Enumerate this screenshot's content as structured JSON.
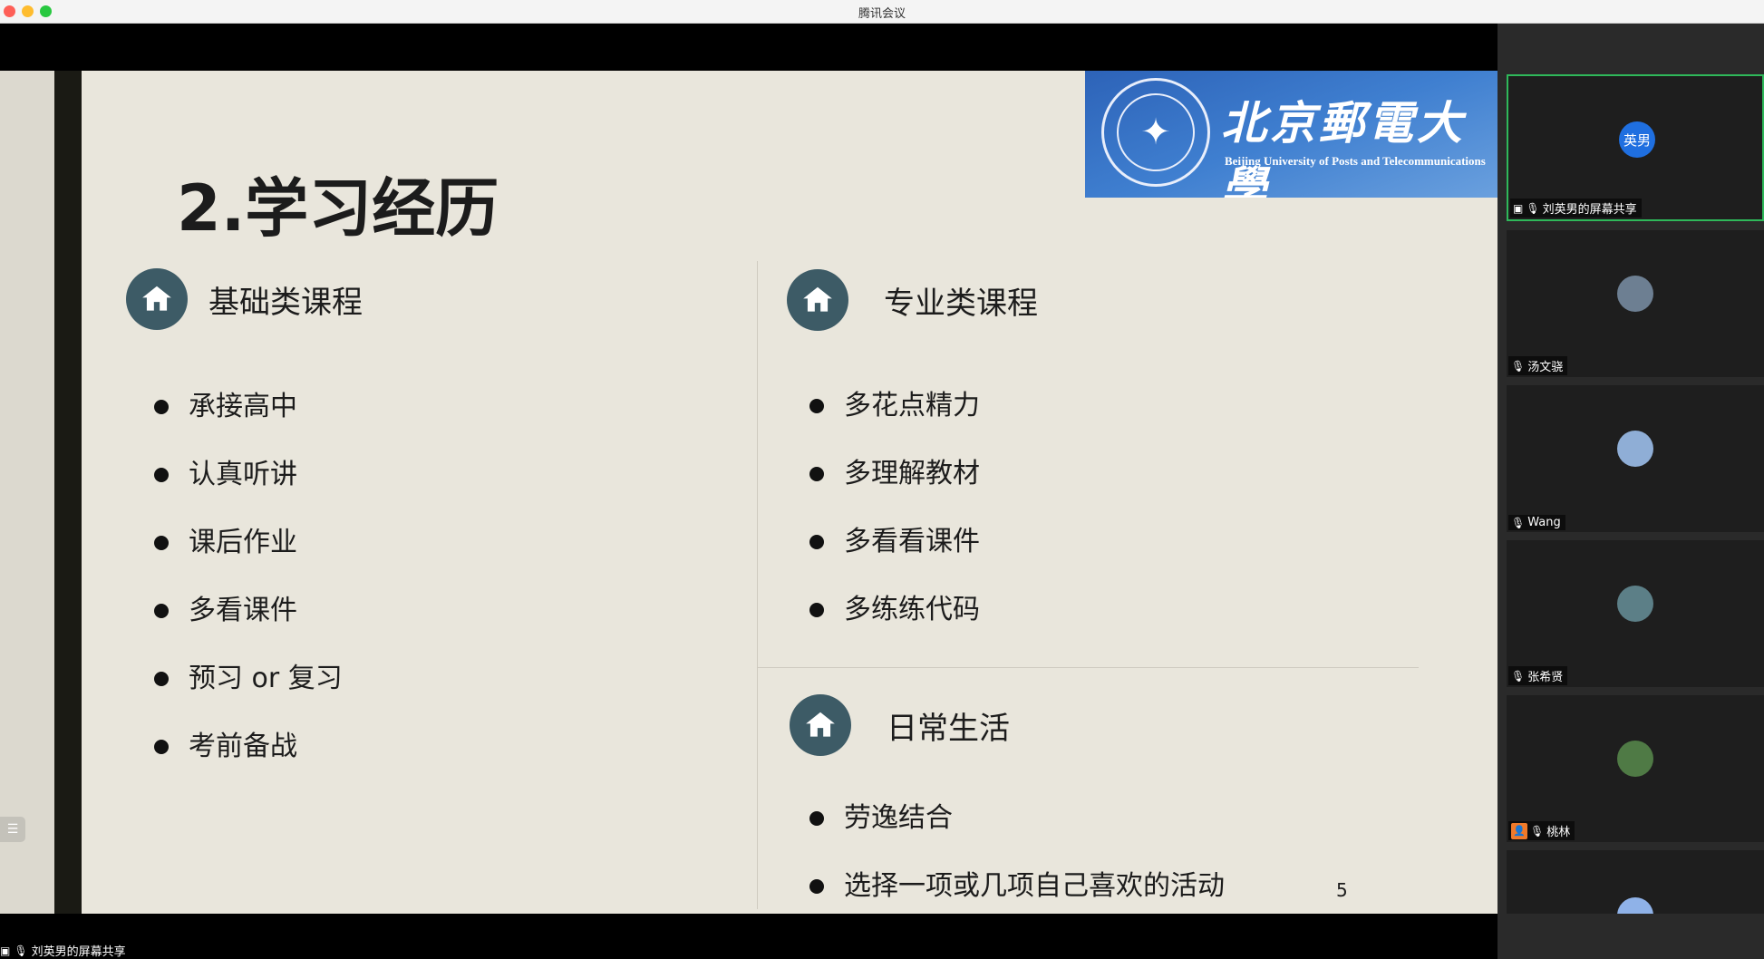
{
  "window": {
    "title": "腾讯会议"
  },
  "slide": {
    "title": "2.学习经历",
    "logo_cn": "北京郵電大學",
    "logo_en": "Beijing University of Posts and Telecommunications",
    "page_number": "5",
    "sections": {
      "basic": {
        "label": "基础类课程",
        "items": [
          "承接高中",
          "认真听讲",
          "课后作业",
          "多看课件",
          "预习 or 复习",
          "考前备战"
        ]
      },
      "major": {
        "label": "专业类课程",
        "items": [
          "多花点精力",
          "多理解教材",
          "多看看课件",
          "多练练代码"
        ]
      },
      "daily": {
        "label": "日常生活",
        "items": [
          "劳逸结合",
          "选择一项或几项自己喜欢的活动"
        ]
      }
    }
  },
  "share_footer": {
    "label": "刘英男的屏幕共享"
  },
  "participants": [
    {
      "name": "刘英男的屏幕共享",
      "avatar_text": "英男",
      "avatar_color": "#1f6fe0",
      "active": true
    },
    {
      "name": "汤文骁",
      "avatar_text": "",
      "avatar_color": "#6d7f92"
    },
    {
      "name": "Wang",
      "avatar_text": "",
      "avatar_color": "#8faed6"
    },
    {
      "name": "张希贤",
      "avatar_text": "",
      "avatar_color": "#5c7f87"
    },
    {
      "name": "桃林",
      "avatar_text": "",
      "avatar_color": "#4f7a45"
    },
    {
      "name": "",
      "avatar_text": "",
      "avatar_color": "#8fb2e8"
    }
  ],
  "icons": {
    "section": "house-icon",
    "share": "screen-share-icon",
    "mic": "microphone-icon",
    "mic_muted": "microphone-muted-icon",
    "user": "user-icon",
    "list": "list-icon"
  }
}
